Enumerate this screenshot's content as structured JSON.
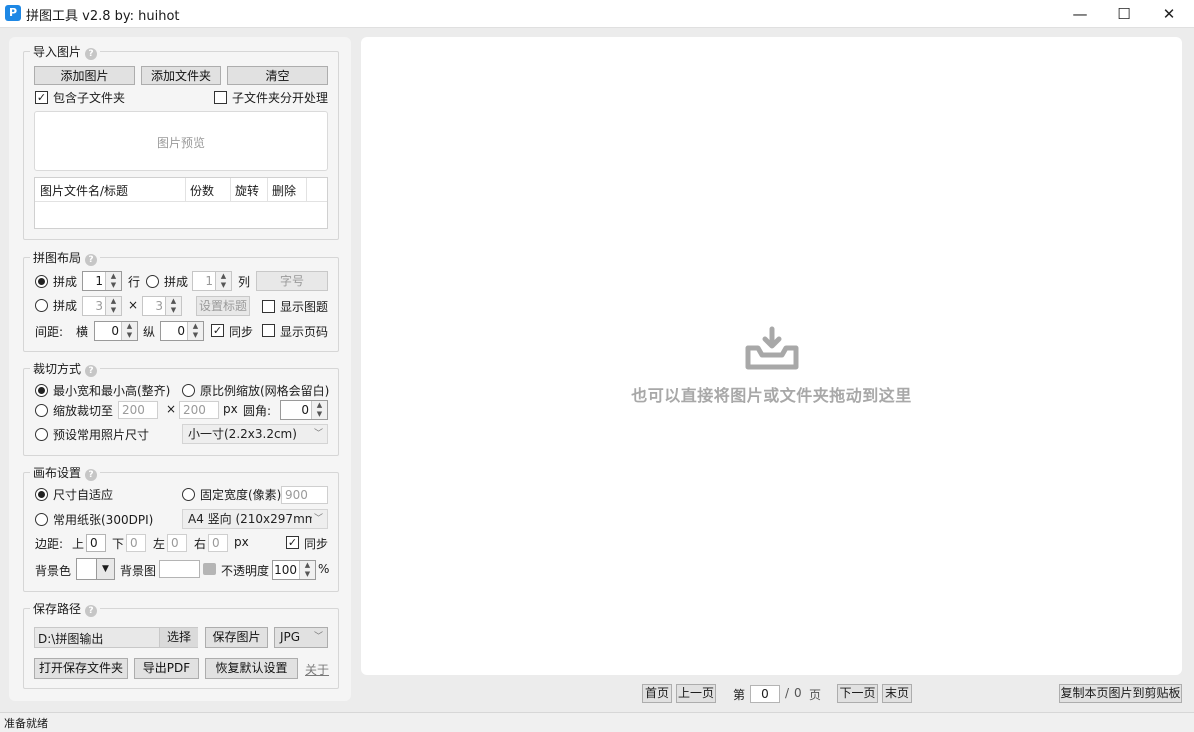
{
  "window": {
    "title": "拼图工具 v2.8 by: huihot",
    "icon_letter": "P",
    "minimize": "—",
    "maximize": "☐",
    "close": "✕"
  },
  "import": {
    "title": "导入图片",
    "add_image": "添加图片",
    "add_folder": "添加文件夹",
    "clear": "清空",
    "include_subfolders": "包含子文件夹",
    "include_subfolders_checked": true,
    "subfolder_separate": "子文件夹分开处理",
    "subfolder_separate_checked": false,
    "preview_placeholder": "图片预览",
    "columns": [
      "图片文件名/标题",
      "份数",
      "旋转",
      "删除"
    ]
  },
  "layout": {
    "title": "拼图布局",
    "mode1_label": "拼成",
    "rows_value": "1",
    "rows_unit": "行",
    "mode2_label": "拼成",
    "cols_value": "1",
    "cols_unit": "列",
    "font_button": "字号",
    "mode3_label": "拼成",
    "grid_a": "3",
    "grid_x": "×",
    "grid_b": "3",
    "set_title_button": "设置标题",
    "show_title": "显示图题",
    "spacing_label": "间距:",
    "horizontal_label": "横",
    "horizontal_value": "0",
    "vertical_label": "纵",
    "vertical_value": "0",
    "sync_label": "同步",
    "sync_checked": true,
    "show_page_number": "显示页码"
  },
  "crop": {
    "title": "裁切方式",
    "option_min": "最小宽和最小高(整齐)",
    "option_ratio": "原比例缩放(网格会留白)",
    "option_scale": "缩放裁切至",
    "width_value": "200",
    "times": "×",
    "height_value": "200",
    "px": "px",
    "radius_label": "圆角:",
    "radius_value": "0",
    "option_photo": "预设常用照片尺寸",
    "photo_size": "小一寸(2.2x3.2cm)"
  },
  "canvas": {
    "title": "画布设置",
    "option_auto": "尺寸自适应",
    "option_fixed": "固定宽度(像素)",
    "fixed_value": "900",
    "option_paper": "常用纸张(300DPI)",
    "paper_value": "A4 竖向 (210x297mm)",
    "margin_label": "边距:",
    "top_label": "上",
    "top_value": "0",
    "bottom_label": "下",
    "bottom_value": "0",
    "left_label": "左",
    "left_value": "0",
    "right_label": "右",
    "right_value": "0",
    "px": "px",
    "sync_label": "同步",
    "sync_checked": true,
    "bg_color_label": "背景色",
    "bg_image_label": "背景图",
    "opacity_label": "不透明度",
    "opacity_value": "100",
    "percent": "%"
  },
  "save": {
    "title": "保存路径",
    "path_value": "D:\\拼图输出",
    "choose": "选择",
    "save_image": "保存图片",
    "format": "JPG",
    "open_folder": "打开保存文件夹",
    "export_pdf": "导出PDF",
    "restore_defaults": "恢复默认设置",
    "about": "关于"
  },
  "preview": {
    "drop_hint": "也可以直接将图片或文件夹拖动到这里"
  },
  "nav": {
    "first": "首页",
    "prev": "上一页",
    "page_prefix": "第",
    "page_value": "0",
    "page_sep": "/",
    "page_total": "0",
    "page_suffix": "页",
    "next": "下一页",
    "last": "末页",
    "copy_clipboard": "复制本页图片到剪贴板"
  },
  "status": {
    "text": "准备就绪"
  },
  "colors": {
    "accent": "#1e88e5",
    "panel_bg": "#f5f5f5",
    "preview_bg": "#ffffff",
    "hint_gray": "#a8a8a8"
  }
}
